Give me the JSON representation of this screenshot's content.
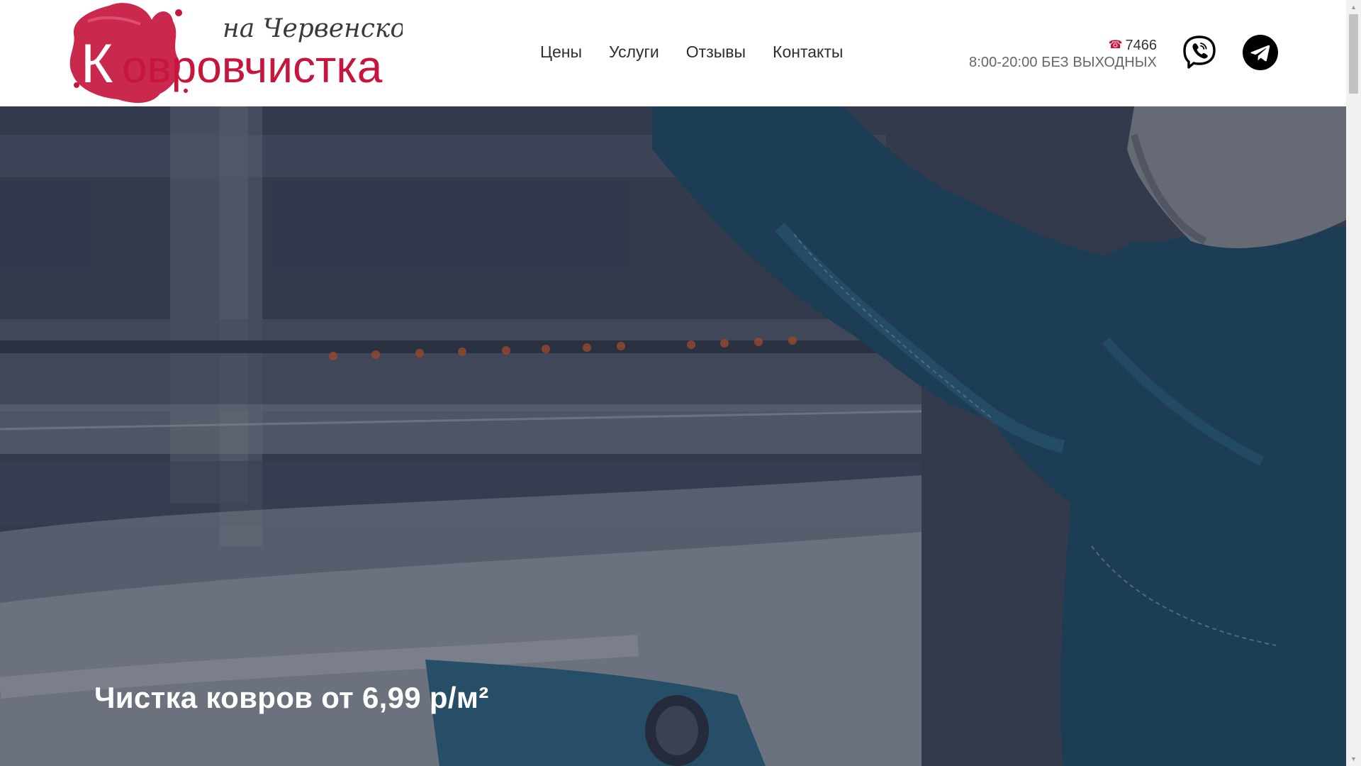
{
  "header": {
    "logo": {
      "brand": "Ковровчистка",
      "tagline": "на Червенском",
      "brand_color": "#c6163d"
    },
    "nav": [
      {
        "label": "Цены"
      },
      {
        "label": "Услуги"
      },
      {
        "label": "Отзывы"
      },
      {
        "label": "Контакты"
      }
    ],
    "contact": {
      "phone_icon": "☎",
      "phone": "7466",
      "hours": "8:00-20:00 БЕЗ ВЫХОДНЫХ"
    },
    "social": {
      "viber_icon": "viber-icon",
      "telegram_icon": "telegram-icon"
    }
  },
  "hero": {
    "title": "Чистка ковров от 6,99 р/м²"
  },
  "colors": {
    "accent": "#c6163d",
    "hero_overlay": "#1e243a",
    "nav_text": "#2e2e2e",
    "hours_text": "#666666"
  }
}
